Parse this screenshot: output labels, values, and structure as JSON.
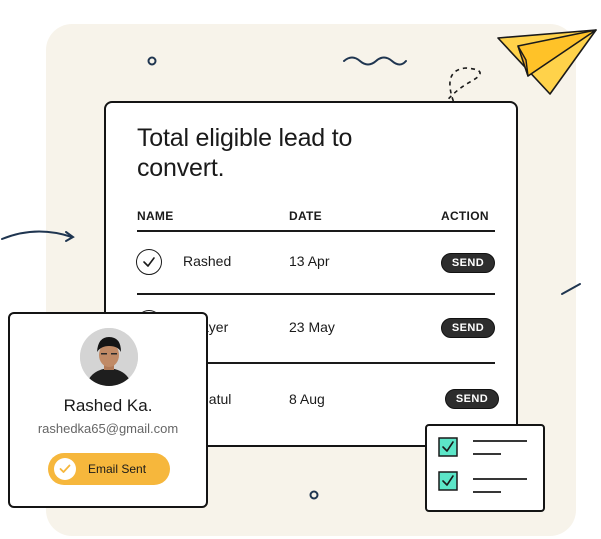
{
  "main_card": {
    "title": "Total eligible lead to convert.",
    "columns": {
      "name": "NAME",
      "date": "DATE",
      "action": "ACTION"
    },
    "rows": [
      {
        "name": "Rashed",
        "date": "13 Apr",
        "action": "SEND"
      },
      {
        "name": "ayer",
        "date": "23 May",
        "action": "SEND"
      },
      {
        "name": "natul",
        "date": "8 Aug",
        "action": "SEND"
      }
    ]
  },
  "profile": {
    "name": "Rashed Ka.",
    "email": "rashedka65@gmail.com",
    "status": "Email Sent"
  },
  "colors": {
    "background_blob": "#f7f3ea",
    "accent_yellow": "#f6b73c",
    "teal_check": "#5ce6c8",
    "dark": "#1a1a1a"
  },
  "icons": [
    "paper-plane-icon",
    "check-circle-icon",
    "checkmark-icon",
    "checkbox-icon",
    "avatar"
  ]
}
